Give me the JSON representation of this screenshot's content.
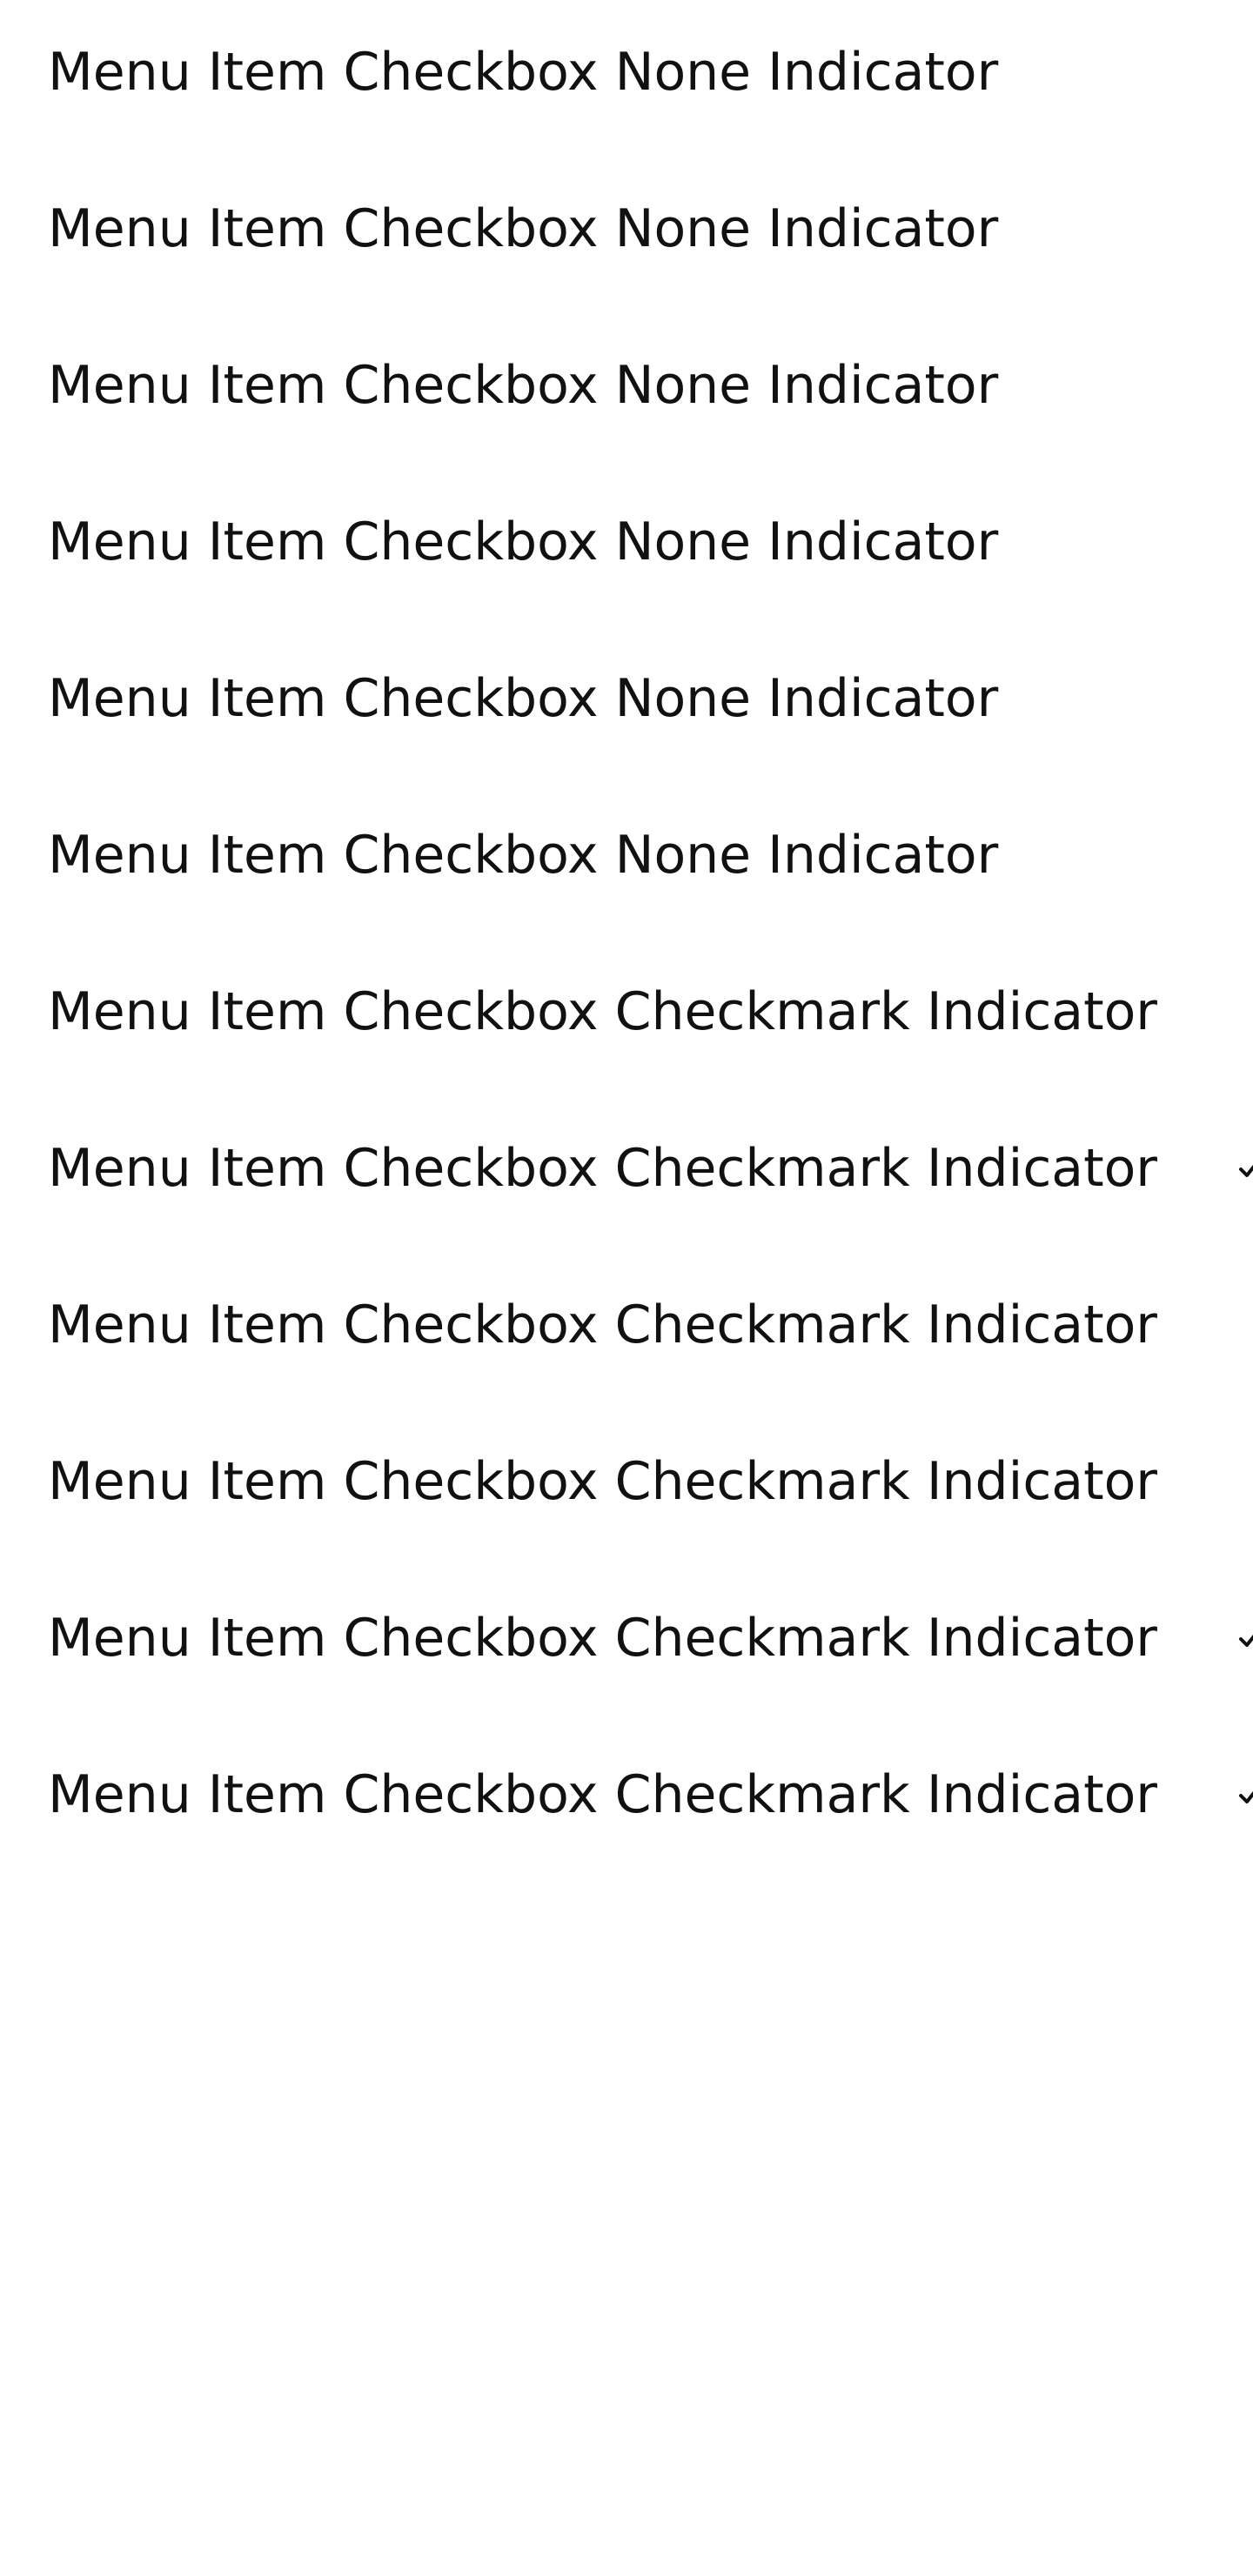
{
  "menu": {
    "items": [
      {
        "label": "Menu Item Checkbox None Indicator",
        "indicator": "none",
        "checked": false
      },
      {
        "label": "Menu Item Checkbox None Indicator",
        "indicator": "none",
        "checked": false
      },
      {
        "label": "Menu Item Checkbox None Indicator",
        "indicator": "none",
        "checked": false
      },
      {
        "label": "Menu Item Checkbox None Indicator",
        "indicator": "none",
        "checked": false
      },
      {
        "label": "Menu Item Checkbox None Indicator",
        "indicator": "none",
        "checked": false
      },
      {
        "label": "Menu Item Checkbox None Indicator",
        "indicator": "none",
        "checked": false
      },
      {
        "label": "Menu Item Checkbox Checkmark Indicator",
        "indicator": "checkmark",
        "checked": false
      },
      {
        "label": "Menu Item Checkbox Checkmark Indicator",
        "indicator": "checkmark",
        "checked": true
      },
      {
        "label": "Menu Item Checkbox Checkmark Indicator",
        "indicator": "checkmark",
        "checked": false
      },
      {
        "label": "Menu Item Checkbox Checkmark Indicator",
        "indicator": "checkmark",
        "checked": false
      },
      {
        "label": "Menu Item Checkbox Checkmark Indicator",
        "indicator": "checkmark",
        "checked": true
      },
      {
        "label": "Menu Item Checkbox Checkmark Indicator",
        "indicator": "checkmark",
        "checked": true
      }
    ]
  },
  "colors": {
    "background": "#ffffff",
    "text": "#111111",
    "checkmark": "#111111"
  },
  "icons": {
    "checkmark": "checkmark-icon"
  }
}
